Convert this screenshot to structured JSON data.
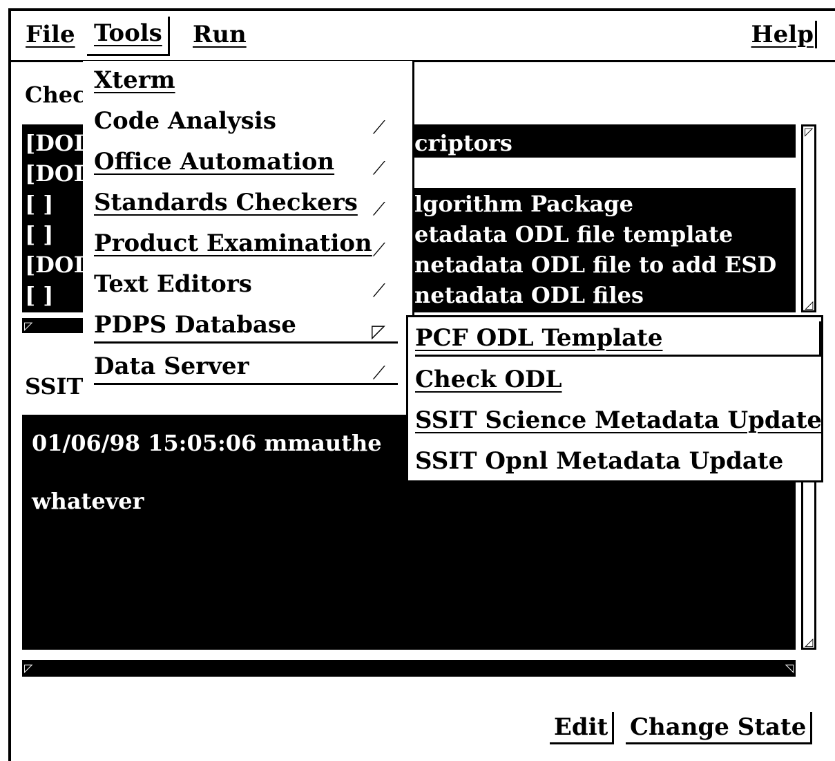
{
  "menubar": {
    "file": "File",
    "tools": "Tools",
    "run": "Run",
    "help": "Help"
  },
  "checklist": {
    "label_visible": "Chec",
    "rows": [
      {
        "status": "[DOI",
        "text": "criptors"
      },
      {
        "status": "[DOI",
        "text": ""
      },
      {
        "status": "[    ]",
        "text": "lgorithm Package"
      },
      {
        "status": "[    ]",
        "text": "etadata ODL file template"
      },
      {
        "status": "[DOI",
        "text": "netadata ODL file to add ESD"
      },
      {
        "status": "[    ]",
        "text": "netadata ODL files"
      }
    ]
  },
  "log": {
    "label_visible": "SSIT",
    "lines": [
      "01/06/98 15:05:06 mmauthe",
      "whatever"
    ]
  },
  "buttons": {
    "edit": "Edit",
    "change_state": "Change State"
  },
  "tools_menu": {
    "items": [
      {
        "label": "Xterm",
        "cascade": false
      },
      {
        "label": "Code Analysis",
        "cascade": true
      },
      {
        "label": "Office Automation",
        "cascade": true
      },
      {
        "label": "Standards Checkers",
        "cascade": true
      },
      {
        "label": "Product Examination",
        "cascade": true
      },
      {
        "label": "Text Editors",
        "cascade": true
      },
      {
        "label": "PDPS Database",
        "cascade": true,
        "active": true
      },
      {
        "label": "Data Server",
        "cascade": true
      }
    ]
  },
  "pdps_submenu": {
    "items": [
      "PCF ODL Template",
      "Check ODL",
      "SSIT Science Metadata Update",
      "SSIT Opnl Metadata Update"
    ]
  }
}
